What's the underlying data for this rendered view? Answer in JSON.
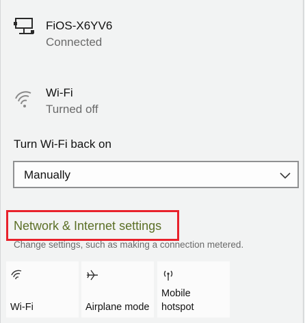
{
  "networks": [
    {
      "name": "FiOS-X6YV6",
      "status": "Connected",
      "icon": "ethernet-monitor-icon"
    },
    {
      "name": "Wi-Fi",
      "status": "Turned off",
      "icon": "wifi-off-icon"
    }
  ],
  "turn_wifi": {
    "label": "Turn Wi-Fi back on",
    "selected": "Manually"
  },
  "settings": {
    "link": "Network & Internet settings",
    "description": "Change settings, such as making a connection metered."
  },
  "quick_actions": [
    {
      "label": "Wi-Fi",
      "icon": "wifi-icon"
    },
    {
      "label": "Airplane mode",
      "icon": "airplane-icon"
    },
    {
      "label_line1": "Mobile",
      "label_line2": "hotspot",
      "icon": "hotspot-icon"
    }
  ],
  "colors": {
    "link": "#5b6f26",
    "highlight": "#e8212b"
  }
}
